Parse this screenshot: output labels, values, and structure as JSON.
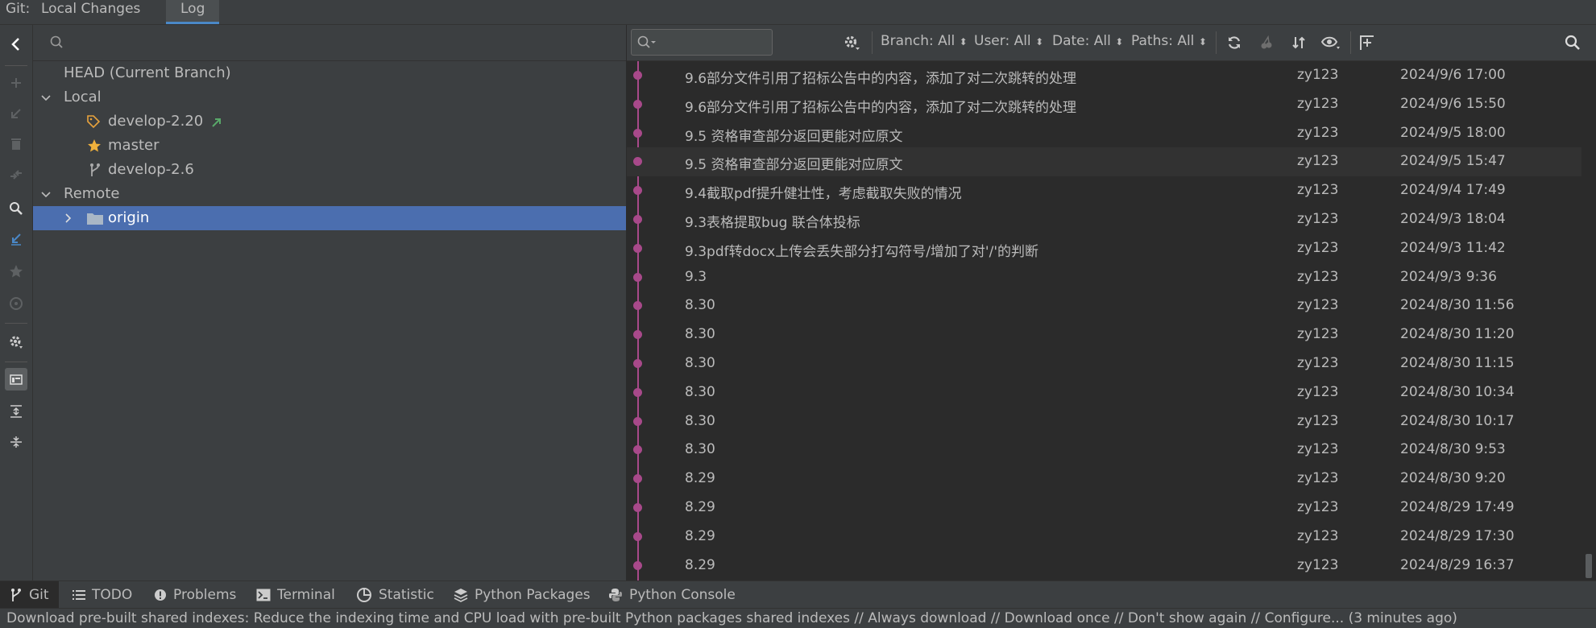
{
  "topbar": {
    "label": "Git:",
    "tabs": [
      {
        "label": "Local Changes",
        "active": false
      },
      {
        "label": "Log",
        "active": true
      }
    ]
  },
  "branches": {
    "search_placeholder": "",
    "items": [
      {
        "label": "HEAD (Current Branch)",
        "level": 0
      },
      {
        "label": "Local",
        "level": 0,
        "expanded": true
      },
      {
        "label": "develop-2.20",
        "level": 1,
        "icon": "tag-icon",
        "tracking": "outgoing-arrow-icon"
      },
      {
        "label": "master",
        "level": 1,
        "icon": "star-icon"
      },
      {
        "label": "develop-2.6",
        "level": 1,
        "icon": "branch-icon"
      },
      {
        "label": "Remote",
        "level": 0,
        "expanded": true
      },
      {
        "label": "origin",
        "level": 1,
        "icon": "folder-icon",
        "selected": true
      }
    ]
  },
  "log_toolbar": {
    "filters": [
      {
        "label": "Branch: All"
      },
      {
        "label": "User: All"
      },
      {
        "label": "Date: All"
      },
      {
        "label": "Paths: All"
      }
    ]
  },
  "commits": [
    {
      "message": "9.6部分文件引用了招标公告中的内容，添加了对二次跳转的处理",
      "author": "zy123",
      "date": "2024/9/6 17:00"
    },
    {
      "message": "9.6部分文件引用了招标公告中的内容，添加了对二次跳转的处理",
      "author": "zy123",
      "date": "2024/9/6 15:50"
    },
    {
      "message": "9.5 资格审查部分返回更能对应原文",
      "author": "zy123",
      "date": "2024/9/5 18:00"
    },
    {
      "message": "9.5 资格审查部分返回更能对应原文",
      "author": "zy123",
      "date": "2024/9/5 15:47"
    },
    {
      "message": "9.4截取pdf提升健壮性，考虑截取失败的情况",
      "author": "zy123",
      "date": "2024/9/4 17:49"
    },
    {
      "message": "9.3表格提取bug 联合体投标",
      "author": "zy123",
      "date": "2024/9/3 18:04"
    },
    {
      "message": "9.3pdf转docx上传会丢失部分打勾符号/增加了对'/'的判断",
      "author": "zy123",
      "date": "2024/9/3 11:42"
    },
    {
      "message": "9.3",
      "author": "zy123",
      "date": "2024/9/3 9:36"
    },
    {
      "message": "8.30",
      "author": "zy123",
      "date": "2024/8/30 11:56"
    },
    {
      "message": "8.30",
      "author": "zy123",
      "date": "2024/8/30 11:20"
    },
    {
      "message": "8.30",
      "author": "zy123",
      "date": "2024/8/30 11:15"
    },
    {
      "message": "8.30",
      "author": "zy123",
      "date": "2024/8/30 10:34"
    },
    {
      "message": "8.30",
      "author": "zy123",
      "date": "2024/8/30 10:17"
    },
    {
      "message": "8.30",
      "author": "zy123",
      "date": "2024/8/30 9:53"
    },
    {
      "message": "8.29",
      "author": "zy123",
      "date": "2024/8/30 9:20"
    },
    {
      "message": "8.29",
      "author": "zy123",
      "date": "2024/8/29 17:49"
    },
    {
      "message": "8.29",
      "author": "zy123",
      "date": "2024/8/29 17:30"
    },
    {
      "message": "8.29",
      "author": "zy123",
      "date": "2024/8/29 16:37"
    }
  ],
  "bottom_tabs": [
    {
      "label": "Git",
      "icon": "git-branch-icon",
      "active": true
    },
    {
      "label": "TODO",
      "icon": "list-icon"
    },
    {
      "label": "Problems",
      "icon": "warning-icon"
    },
    {
      "label": "Terminal",
      "icon": "terminal-icon"
    },
    {
      "label": "Statistic",
      "icon": "pie-chart-icon"
    },
    {
      "label": "Python Packages",
      "icon": "layers-icon"
    },
    {
      "label": "Python Console",
      "icon": "python-icon"
    }
  ],
  "status": {
    "text": "Download pre-built shared indexes: Reduce the indexing time and CPU load with pre-built Python packages shared indexes // Always download // Download once // Don't show again // Configure... (3 minutes ago)"
  },
  "colors": {
    "accent": "#4a88c7",
    "selection": "#4b6eaf",
    "graph": "#a8498a",
    "tag": "#e8a33d",
    "star": "#f0b13c",
    "arrow": "#59a869"
  }
}
